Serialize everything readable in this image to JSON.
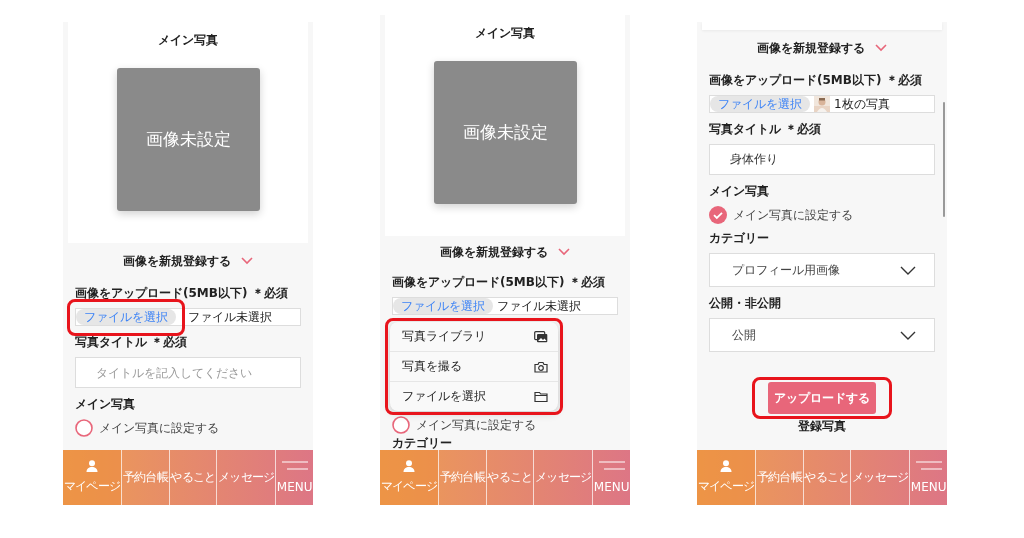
{
  "screens": [
    {
      "blocks": [
        {
          "kind": "photo_card",
          "title": "メイン写真",
          "image_text": "画像未設定"
        },
        {
          "kind": "section_toggle",
          "label": "画像を新規登録する"
        },
        {
          "kind": "label",
          "text": "画像をアップロード(5MB以下) ＊必須"
        },
        {
          "kind": "file_field",
          "button": "ファイルを選択",
          "status": "ファイル未選択",
          "highlighted": true
        },
        {
          "kind": "label",
          "text": "写真タイトル ＊必須"
        },
        {
          "kind": "text_field",
          "placeholder": "タイトルを記入してください"
        },
        {
          "kind": "label",
          "text": "メイン写真"
        },
        {
          "kind": "checkbox",
          "label": "メイン写真に設定する",
          "checked": false
        }
      ],
      "nav": [
        {
          "label": "マイページ",
          "selected": true
        },
        {
          "label": "予約台帳",
          "selected": false
        },
        {
          "label": "やること",
          "selected": false
        },
        {
          "label": "メッセージ",
          "selected": false
        },
        {
          "label": "MENU",
          "selected": false
        }
      ]
    },
    {
      "blocks": [
        {
          "kind": "photo_card",
          "title": "メイン写真",
          "image_text": "画像未設定"
        },
        {
          "kind": "section_toggle",
          "label": "画像を新規登録する"
        },
        {
          "kind": "label",
          "text": "画像をアップロード(5MB以下) ＊必須"
        },
        {
          "kind": "file_field",
          "button": "ファイルを選択",
          "status": "ファイル未選択"
        },
        {
          "kind": "menu",
          "highlighted": true,
          "items": [
            {
              "label": "写真ライブラリ"
            },
            {
              "label": "写真を撮る"
            },
            {
              "label": "ファイルを選択"
            }
          ]
        },
        {
          "kind": "checkbox",
          "label": "メイン写真に設定する",
          "checked": false
        },
        {
          "kind": "label",
          "text": "カテゴリー"
        }
      ],
      "nav": [
        {
          "label": "マイページ",
          "selected": true
        },
        {
          "label": "予約台帳",
          "selected": false
        },
        {
          "label": "やること",
          "selected": false
        },
        {
          "label": "メッセージ",
          "selected": false
        },
        {
          "label": "MENU",
          "selected": false
        }
      ]
    },
    {
      "scrollbar": true,
      "blocks": [
        {
          "kind": "card_edge"
        },
        {
          "kind": "section_toggle",
          "label": "画像を新規登録する"
        },
        {
          "kind": "label",
          "text": "画像をアップロード(5MB以下) ＊必須"
        },
        {
          "kind": "file_field",
          "button": "ファイルを選択",
          "status": "1枚の写真"
        },
        {
          "kind": "label",
          "text": "写真タイトル ＊必須"
        },
        {
          "kind": "text_field",
          "value": "身体作り"
        },
        {
          "kind": "label",
          "text": "メイン写真"
        },
        {
          "kind": "checkbox",
          "label": "メイン写真に設定する",
          "checked": true
        },
        {
          "kind": "label",
          "text": "カテゴリー"
        },
        {
          "kind": "select",
          "value": "プロフィール用画像"
        },
        {
          "kind": "label",
          "text": "公開・非公開"
        },
        {
          "kind": "select",
          "value": "公開"
        },
        {
          "kind": "button",
          "label": "アップロードする",
          "highlighted": true
        },
        {
          "kind": "heading",
          "text": "登録写真"
        }
      ],
      "nav": [
        {
          "label": "マイページ",
          "selected": true
        },
        {
          "label": "予約台帳",
          "selected": false
        },
        {
          "label": "やること",
          "selected": false
        },
        {
          "label": "メッセージ",
          "selected": false
        },
        {
          "label": "MENU",
          "selected": false
        }
      ]
    }
  ]
}
